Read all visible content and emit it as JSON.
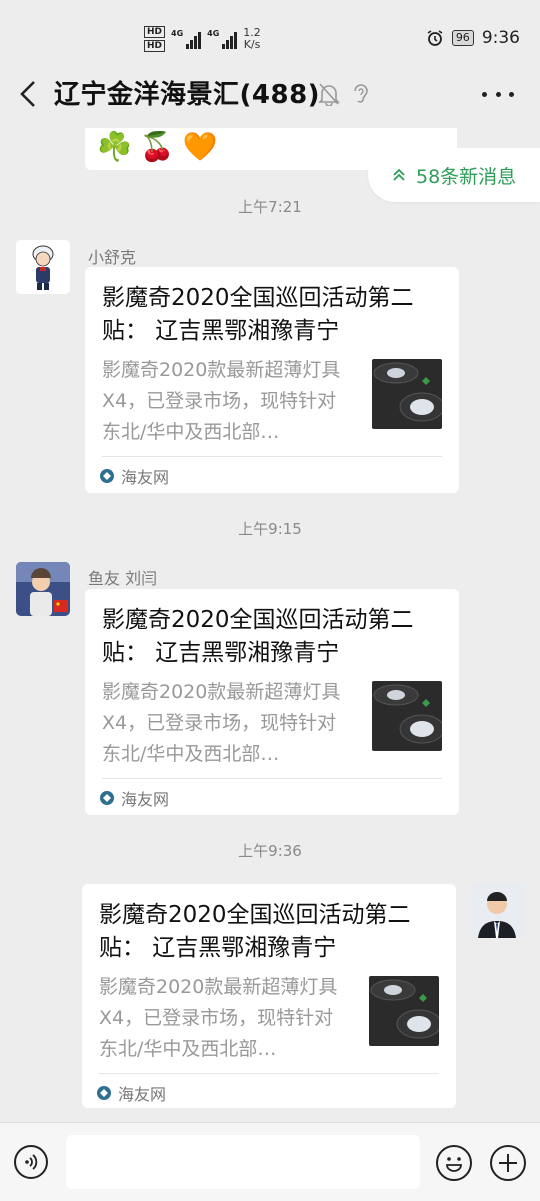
{
  "status_bar": {
    "hd1": "HD",
    "hd2": "HD",
    "sig1_label": "4G",
    "sig2_label": "4G",
    "speed_value": "1.2",
    "speed_unit": "K/s",
    "battery": "96",
    "time": "9:36"
  },
  "header": {
    "title": "辽宁金洋海景汇(488)"
  },
  "chat": {
    "top_emojis": "☘️🍒🧡",
    "new_messages": "58条新消息",
    "messages": [
      {
        "time": "上午7:21",
        "sender": "小舒克",
        "title": "影魔奇2020全国巡回活动第二贴： 辽吉黑鄂湘豫青宁",
        "desc": "影魔奇2020款最新超薄灯具X4，已登录市场，现特针对东北/华中及西北部…",
        "source": "海友网"
      },
      {
        "time": "上午9:15",
        "sender": "鱼友 刘闫",
        "title": "影魔奇2020全国巡回活动第二贴： 辽吉黑鄂湘豫青宁",
        "desc": "影魔奇2020款最新超薄灯具X4，已登录市场，现特针对东北/华中及西北部…",
        "source": "海友网"
      },
      {
        "time": "上午9:36",
        "sender": "",
        "title": "影魔奇2020全国巡回活动第二贴： 辽吉黑鄂湘豫青宁",
        "desc": "影魔奇2020款最新超薄灯具X4，已登录市场，现特针对东北/华中及西北部…",
        "source": "海友网"
      }
    ]
  },
  "colors": {
    "accent_green": "#2e9d58",
    "background": "#ededed"
  }
}
